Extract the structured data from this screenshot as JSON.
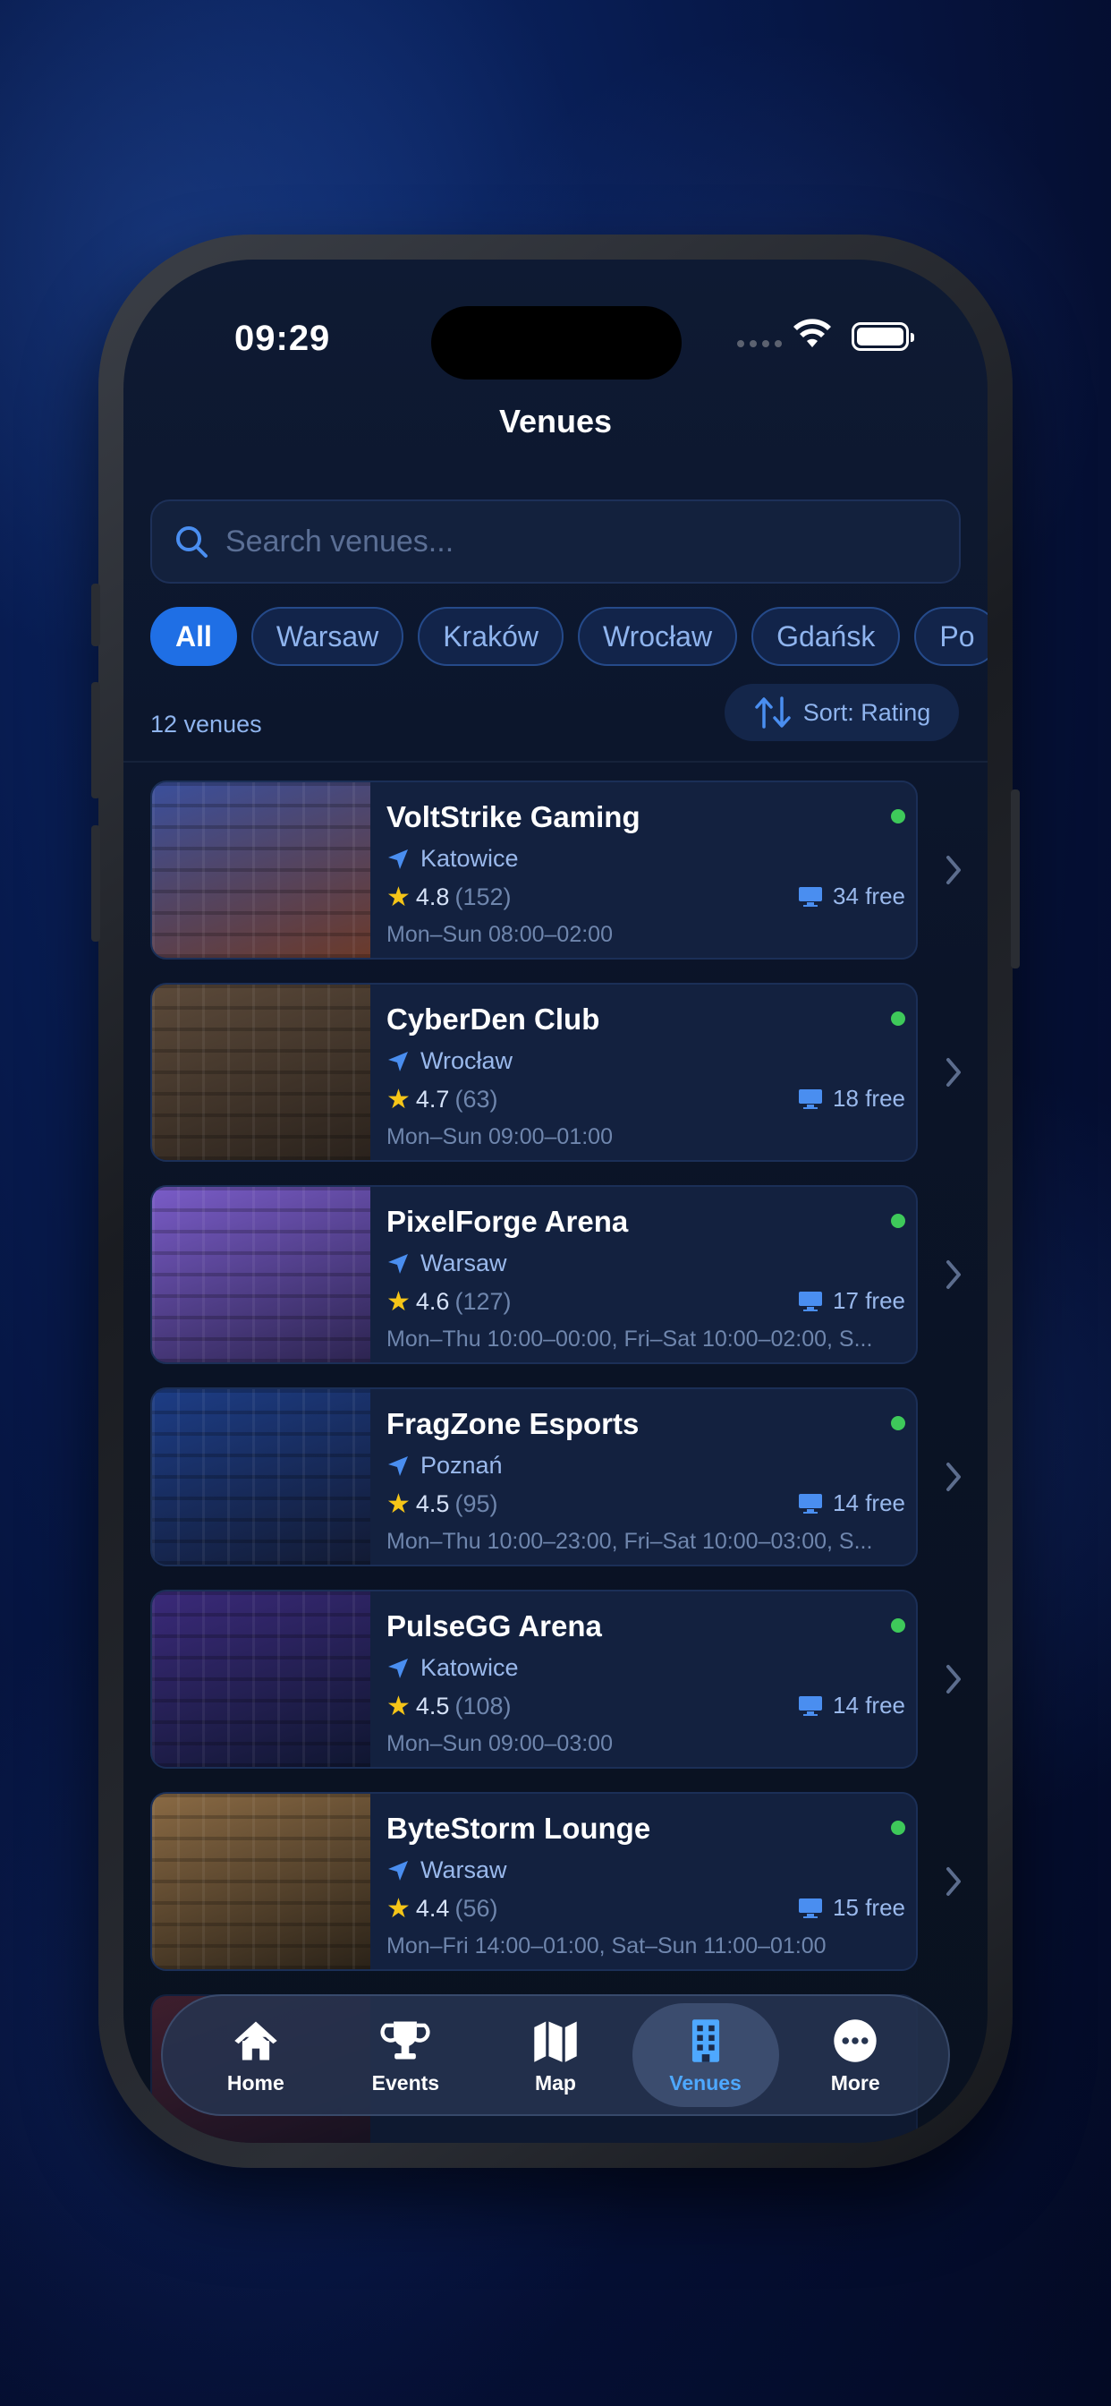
{
  "status_bar": {
    "time": "09:29"
  },
  "header": {
    "title": "Venues"
  },
  "search": {
    "placeholder": "Search venues..."
  },
  "filters": [
    {
      "label": "All",
      "active": true
    },
    {
      "label": "Warsaw",
      "active": false
    },
    {
      "label": "Kraków",
      "active": false
    },
    {
      "label": "Wrocław",
      "active": false
    },
    {
      "label": "Gdańsk",
      "active": false
    },
    {
      "label": "Po",
      "active": false
    }
  ],
  "summary": {
    "count": "12 venues",
    "sort_label": "Sort: Rating"
  },
  "venues": [
    {
      "name": "VoltStrike Gaming",
      "city": "Katowice",
      "rating": "4.8",
      "reviews": "(152)",
      "hours": "Mon–Sun 08:00–02:00",
      "free": "34 free",
      "open": true,
      "thumb_colors": [
        "#3a4f9c",
        "#6b3a2a"
      ]
    },
    {
      "name": "CyberDen Club",
      "city": "Wrocław",
      "rating": "4.7",
      "reviews": "(63)",
      "hours": "Mon–Sun 09:00–01:00",
      "free": "18 free",
      "open": true,
      "thumb_colors": [
        "#5c4a3a",
        "#2a221c"
      ]
    },
    {
      "name": "PixelForge Arena",
      "city": "Warsaw",
      "rating": "4.6",
      "reviews": "(127)",
      "hours": "Mon–Thu 10:00–00:00, Fri–Sat 10:00–02:00, S...",
      "free": "17 free",
      "open": true,
      "thumb_colors": [
        "#7a5cc8",
        "#2c2450"
      ]
    },
    {
      "name": "FragZone Esports",
      "city": "Poznań",
      "rating": "4.5",
      "reviews": "(95)",
      "hours": "Mon–Thu 10:00–23:00, Fri–Sat 10:00–03:00, S...",
      "free": "14 free",
      "open": true,
      "thumb_colors": [
        "#1d3d86",
        "#121a33"
      ]
    },
    {
      "name": "PulseGG Arena",
      "city": "Katowice",
      "rating": "4.5",
      "reviews": "(108)",
      "hours": "Mon–Sun 09:00–03:00",
      "free": "14 free",
      "open": true,
      "thumb_colors": [
        "#3b2a7a",
        "#0f1630"
      ]
    },
    {
      "name": "ByteStorm Lounge",
      "city": "Warsaw",
      "rating": "4.4",
      "reviews": "(56)",
      "hours": "Mon–Fri 14:00–01:00, Sat–Sun 11:00–01:00",
      "free": "15 free",
      "open": true,
      "thumb_colors": [
        "#8a6a44",
        "#2a2218"
      ]
    }
  ],
  "tabs": [
    {
      "label": "Home",
      "icon": "house-icon",
      "active": false
    },
    {
      "label": "Events",
      "icon": "trophy-icon",
      "active": false
    },
    {
      "label": "Map",
      "icon": "map-icon",
      "active": false
    },
    {
      "label": "Venues",
      "icon": "building-icon",
      "active": true
    },
    {
      "label": "More",
      "icon": "ellipsis-circle-icon",
      "active": false
    }
  ],
  "colors": {
    "accent": "#1f6fe5",
    "open_status": "#3ec95a",
    "star": "#f5c518",
    "active_tab": "#4ea8ff"
  }
}
